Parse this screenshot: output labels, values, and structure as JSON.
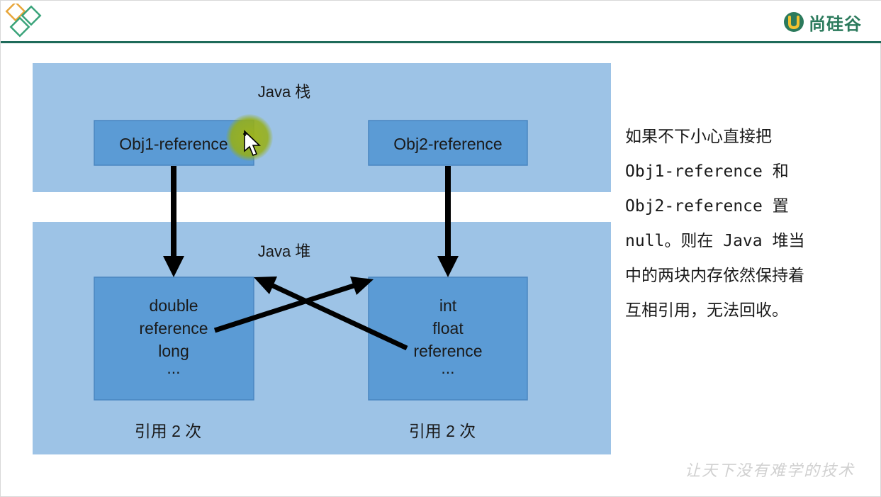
{
  "header": {
    "brand_name": "尚硅谷",
    "colors": {
      "accent_line": "#1f6b5a",
      "brand_green": "#2b7a5c"
    }
  },
  "diagram": {
    "stack_region": {
      "label": "Java 栈",
      "refs": [
        {
          "label": "Obj1-reference"
        },
        {
          "label": "Obj2-reference"
        }
      ]
    },
    "heap_region": {
      "label": "Java 堆",
      "objects": [
        {
          "lines": [
            "double",
            "reference",
            "long",
            "..."
          ],
          "count_label": "引用 2 次"
        },
        {
          "lines": [
            "int",
            "float",
            "reference",
            "..."
          ],
          "count_label": "引用 2 次"
        }
      ]
    },
    "colors": {
      "region_fill": "#9dc3e6",
      "box_fill": "#5b9bd5",
      "box_border": "#4a86c0",
      "arrow": "#000000"
    }
  },
  "explanation": {
    "lines": [
      "如果不下小心直接把",
      "Obj1-reference 和",
      "Obj2-reference 置",
      "null。则在 Java 堆当",
      "中的两块内存依然保持着",
      "互相引用，无法回收。"
    ]
  },
  "footer": {
    "watermark": "让天下没有难学的技术"
  },
  "cursor": {
    "icon": "move-cursor-icon"
  }
}
